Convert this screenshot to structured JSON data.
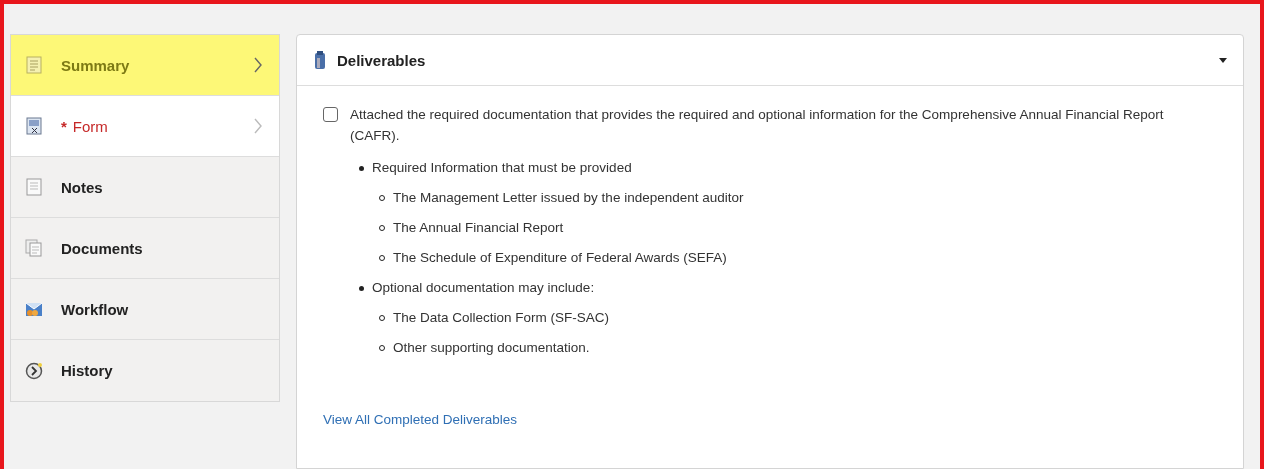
{
  "sidebar": {
    "items": [
      {
        "label": "Summary",
        "kind": "summary",
        "selected": true,
        "required": false,
        "chevron": true
      },
      {
        "label": "Form",
        "kind": "form",
        "selected": false,
        "required": true,
        "marker": "*",
        "chevron": true
      },
      {
        "label": "Notes",
        "kind": "notes",
        "selected": false,
        "required": false,
        "chevron": false
      },
      {
        "label": "Documents",
        "kind": "documents",
        "selected": false,
        "required": false,
        "chevron": false
      },
      {
        "label": "Workflow",
        "kind": "workflow",
        "selected": false,
        "required": false,
        "chevron": false
      },
      {
        "label": "History",
        "kind": "history",
        "selected": false,
        "required": false,
        "chevron": false
      }
    ]
  },
  "panel": {
    "title": "Deliverables",
    "checkbox": {
      "label": "Attached the required documentation that provides the required and optional information for the Comprehensive Annual Financial Report (CAFR).",
      "checked": false
    },
    "list": [
      {
        "text": "Required Information that must be provided",
        "children": [
          {
            "text": "The Management Letter issued by the independent auditor"
          },
          {
            "text": "The Annual Financial Report"
          },
          {
            "text": "The Schedule of Expenditure of Federal Awards (SEFA)"
          }
        ]
      },
      {
        "text": "Optional documentation may include:",
        "children": [
          {
            "text": "The Data Collection Form (SF-SAC)"
          },
          {
            "text": "Other supporting documentation."
          }
        ]
      }
    ],
    "link": "View All Completed Deliverables"
  }
}
